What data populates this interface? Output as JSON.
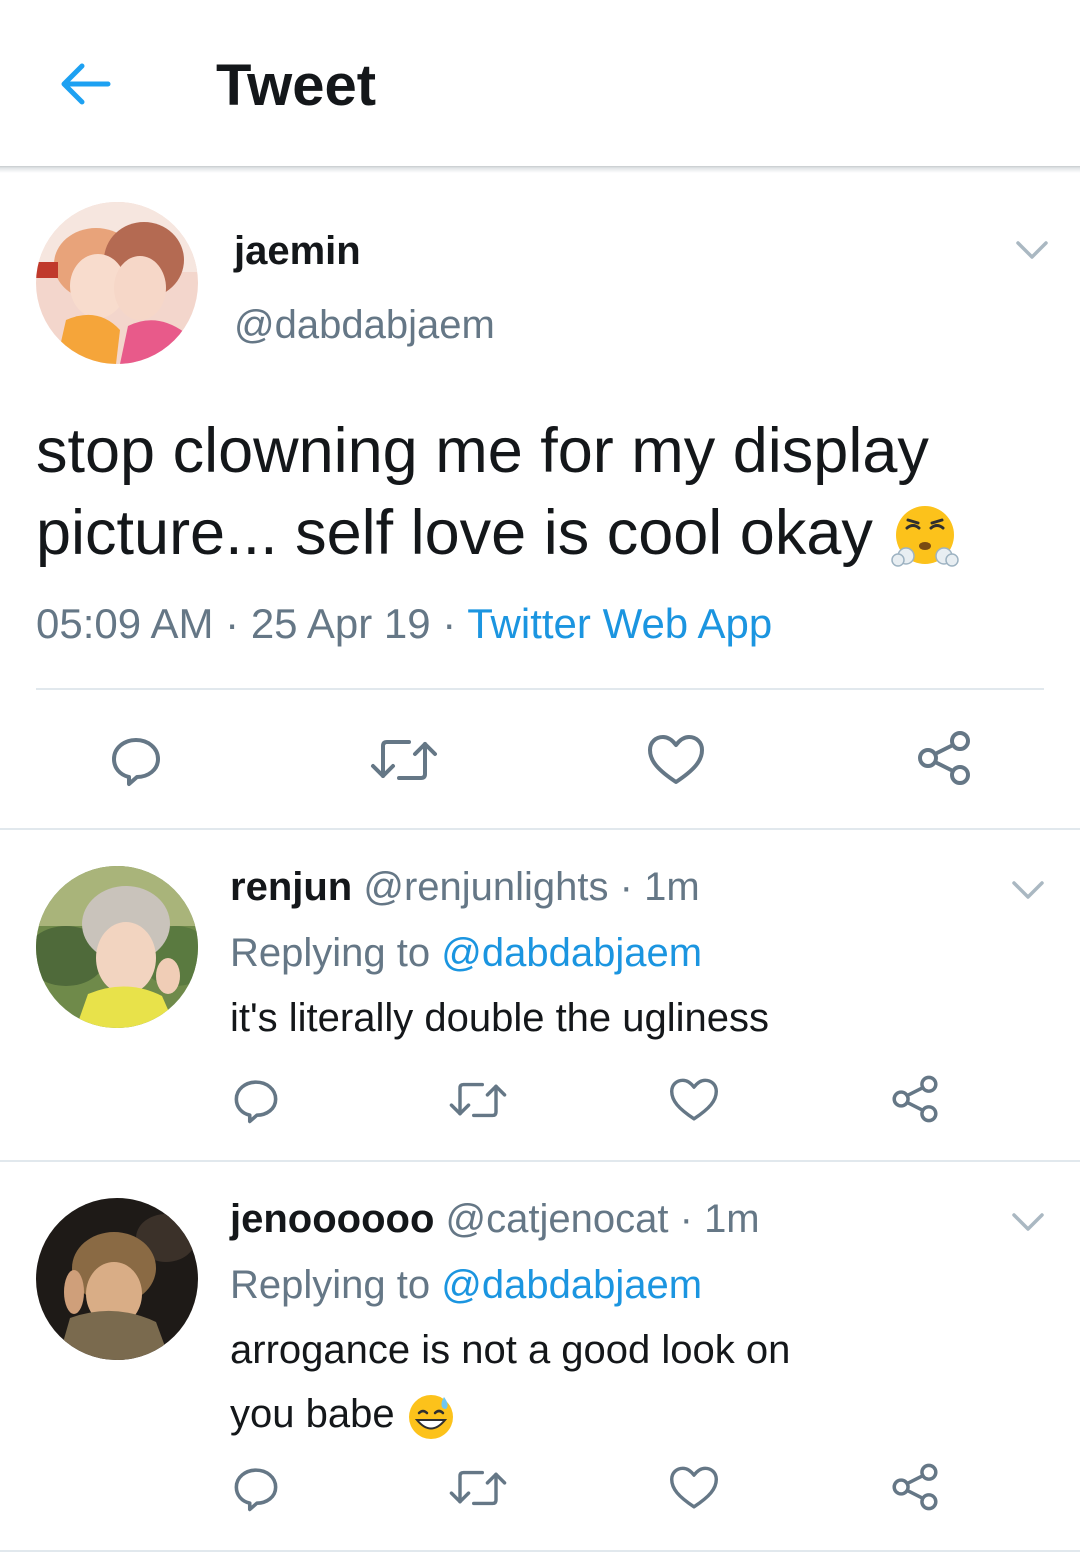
{
  "header": {
    "title": "Tweet",
    "back_icon": "arrow-left-icon",
    "accent_color": "#1da1f2"
  },
  "main_tweet": {
    "display_name": "jaemin",
    "handle": "@dabdabjaem",
    "text_line1": "stop clowning me for my display",
    "text_line2": "picture... self love is cool okay",
    "emoji": "face-with-steam-from-nose",
    "time": "05:09 AM",
    "date": "25 Apr 19",
    "separator": "·",
    "source": "Twitter Web App",
    "actions": [
      "reply-icon",
      "retweet-icon",
      "like-icon",
      "share-icon"
    ]
  },
  "replies": [
    {
      "display_name": "renjun",
      "handle": "@renjunlights",
      "time": "1m",
      "replying_prefix": "Replying to",
      "replying_to": "@dabdabjaem",
      "text_line1": "it's literally double the ugliness",
      "text_line2": ""
    },
    {
      "display_name": "jenoooooo",
      "handle": "@catjenocat",
      "time": "1m",
      "replying_prefix": "Replying to",
      "replying_to": "@dabdabjaem",
      "text_line1": "arrogance is not a good look on",
      "text_line2": "you babe",
      "emoji": "grinning-face-with-sweat"
    }
  ],
  "colors": {
    "text_primary": "#14171a",
    "text_secondary": "#657786",
    "link": "#1b95e0",
    "divider": "#e1e8ed"
  }
}
